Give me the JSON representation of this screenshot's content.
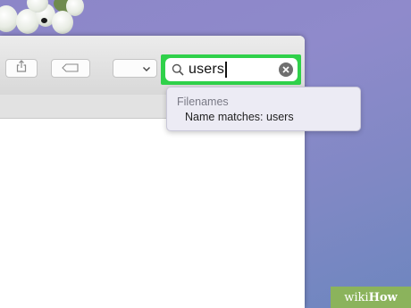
{
  "search": {
    "query": "users"
  },
  "suggestions": {
    "header": "Filenames",
    "items": [
      {
        "label": "Name matches: users"
      }
    ]
  },
  "toolbar": {
    "buttons": [
      {
        "icon": "share-icon"
      },
      {
        "icon": "tag-icon"
      },
      {
        "icon": "chevron-down-icon"
      }
    ]
  },
  "watermark": {
    "wiki": "wiki",
    "how": "How"
  },
  "colors": {
    "highlight": "#2fd14a",
    "desktop": "#8c86c8",
    "wikihow_green": "#8bb35c"
  }
}
